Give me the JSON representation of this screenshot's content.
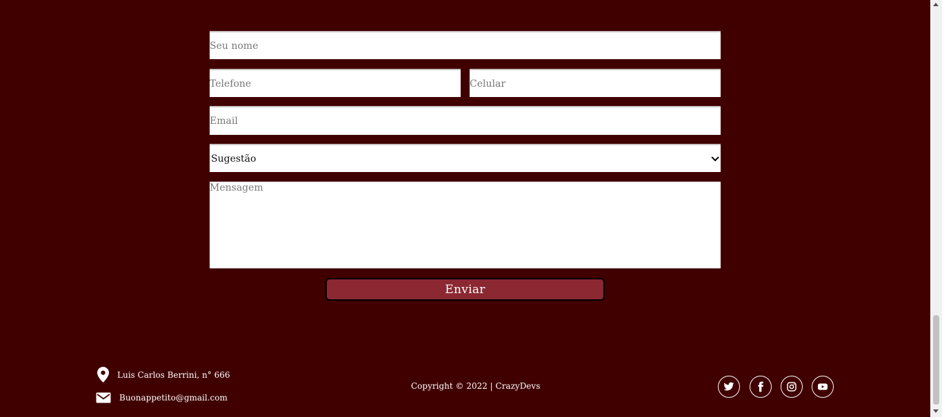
{
  "form": {
    "name_placeholder": "Seu nome",
    "phone_placeholder": "Telefone",
    "mobile_placeholder": "Celular",
    "email_placeholder": "Email",
    "subject_selected": "Sugestão",
    "message_placeholder": "Mensagem",
    "submit_label": "Enviar"
  },
  "footer": {
    "address": "Luis Carlos Berrini, n° 666",
    "email": "Buonappetito@gmail.com",
    "copyright": "Copyright © 2022 | CrazyDevs",
    "social_icons": [
      "twitter-icon",
      "facebook-icon",
      "instagram-icon",
      "youtube-icon"
    ]
  },
  "colors": {
    "background": "#400000",
    "button": "#8b2832",
    "text_light": "#ffffff"
  }
}
